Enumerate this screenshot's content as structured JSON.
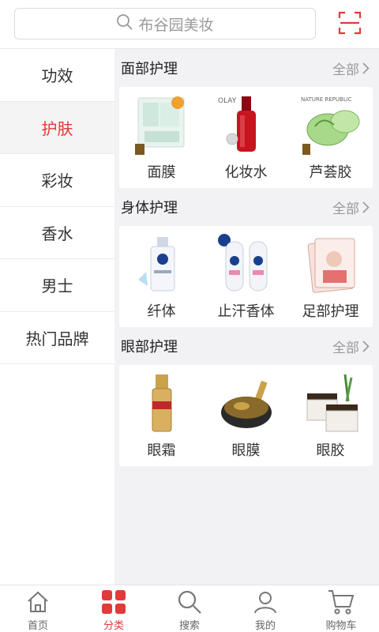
{
  "search": {
    "placeholder": "布谷园美妆"
  },
  "colors": {
    "accent": "#e03a3a",
    "text": "#333333",
    "muted": "#999999"
  },
  "sidebar": {
    "items": [
      {
        "label": "功效",
        "active": false
      },
      {
        "label": "护肤",
        "active": true
      },
      {
        "label": "彩妆",
        "active": false
      },
      {
        "label": "香水",
        "active": false
      },
      {
        "label": "男士",
        "active": false
      },
      {
        "label": "热门品牌",
        "active": false
      }
    ]
  },
  "sections": [
    {
      "title": "面部护理",
      "more": "全部",
      "products": [
        {
          "label": "面膜",
          "icon": "face-mask-product-icon"
        },
        {
          "label": "化妆水",
          "icon": "toner-bottle-icon"
        },
        {
          "label": "芦荟胶",
          "icon": "aloe-gel-jar-icon"
        }
      ]
    },
    {
      "title": "身体护理",
      "more": "全部",
      "products": [
        {
          "label": "纤体",
          "icon": "slimming-bottle-icon"
        },
        {
          "label": "止汗香体",
          "icon": "deodorant-roll-on-icon"
        },
        {
          "label": "足部护理",
          "icon": "foot-mask-pack-icon"
        }
      ]
    },
    {
      "title": "眼部护理",
      "more": "全部",
      "products": [
        {
          "label": "眼霜",
          "icon": "eye-cream-bottle-icon"
        },
        {
          "label": "眼膜",
          "icon": "eye-patch-jar-icon"
        },
        {
          "label": "眼胶",
          "icon": "eye-gel-jar-icon"
        }
      ]
    }
  ],
  "bottom_nav": [
    {
      "label": "首页",
      "icon": "home-icon",
      "active": false
    },
    {
      "label": "分类",
      "icon": "category-grid-icon",
      "active": true
    },
    {
      "label": "搜索",
      "icon": "search-icon",
      "active": false
    },
    {
      "label": "我的",
      "icon": "user-icon",
      "active": false
    },
    {
      "label": "购物车",
      "icon": "cart-icon",
      "active": false
    }
  ]
}
